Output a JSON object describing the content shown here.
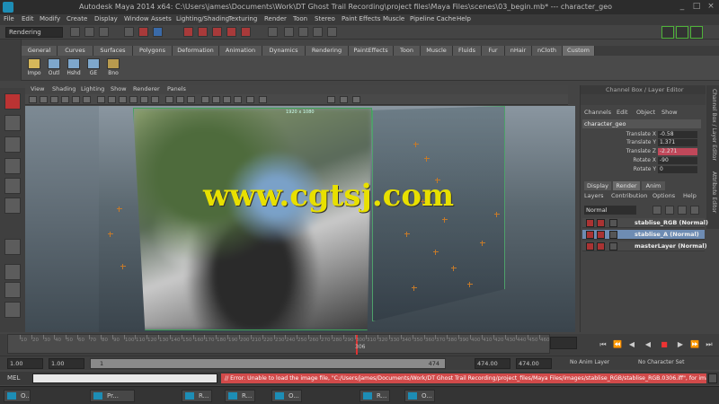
{
  "window": {
    "title": "Autodesk Maya 2014 x64: C:\\Users\\james\\Documents\\Work\\DT Ghost Trail Recording\\project files\\Maya Files\\scenes\\03_begin.mb*  ---  character_geo",
    "minimize": "_",
    "maximize": "□",
    "close": "×"
  },
  "menubar": [
    "File",
    "Edit",
    "Modify",
    "Create",
    "Display",
    "Window",
    "Assets",
    "Lighting/Shading",
    "Texturing",
    "Render",
    "Toon",
    "Stereo",
    "Paint Effects",
    "Muscle",
    "Pipeline Cache",
    "Help"
  ],
  "statusline": {
    "mode": "Rendering"
  },
  "shelf": {
    "tabs": [
      "General",
      "Curves",
      "Surfaces",
      "Polygons",
      "Deformation",
      "Animation",
      "Dynamics",
      "Rendering",
      "PaintEffects",
      "Toon",
      "Muscle",
      "Fluids",
      "Fur",
      "nHair",
      "nCloth",
      "Custom"
    ],
    "active_tab": "Custom",
    "items": [
      "Impo",
      "Outl",
      "Hshd",
      "GE",
      "Bno"
    ]
  },
  "panel_menu": [
    "View",
    "Shading",
    "Lighting",
    "Show",
    "Renderer",
    "Panels"
  ],
  "viewport": {
    "frame_label": "1920 x 1080",
    "watermark": "www.cgtsj.com"
  },
  "channel_box": {
    "header": "Channel Box / Layer Editor",
    "menu": [
      "Channels",
      "Edit",
      "Object",
      "Show"
    ],
    "object": "character_geo",
    "attributes": [
      {
        "name": "Translate X",
        "value": "-0.58"
      },
      {
        "name": "Translate Y",
        "value": "1.371"
      },
      {
        "name": "Translate Z",
        "value": "-2.271"
      },
      {
        "name": "Rotate X",
        "value": "-90"
      },
      {
        "name": "Rotate Y",
        "value": "0"
      }
    ]
  },
  "side_tabs": [
    "Channel Box / Layer Editor",
    "Attribute Editor"
  ],
  "layer_editor": {
    "tabs": [
      "Display",
      "Render",
      "Anim"
    ],
    "active_tab": "Render",
    "menu": [
      "Layers",
      "Contribution",
      "Options",
      "Help"
    ],
    "blend_mode": "Normal",
    "layers": [
      {
        "name": "stablise_RGB (Normal)",
        "selected": false
      },
      {
        "name": "stablise_A (Normal)",
        "selected": true
      },
      {
        "name": "masterLayer (Normal)",
        "selected": false
      }
    ]
  },
  "timeline": {
    "ticks": [
      "10",
      "20",
      "30",
      "40",
      "50",
      "60",
      "70",
      "80",
      "90",
      "100",
      "110",
      "120",
      "130",
      "140",
      "150",
      "160",
      "170",
      "180",
      "190",
      "200",
      "210",
      "220",
      "230",
      "240",
      "250",
      "260",
      "270",
      "280",
      "290",
      "300",
      "310",
      "320",
      "330",
      "340",
      "350",
      "360",
      "370",
      "380",
      "390",
      "400",
      "410",
      "420",
      "430",
      "440",
      "450",
      "460"
    ],
    "current_frame": "306",
    "current_fraction": 0.64
  },
  "range": {
    "start": "1.00",
    "playback_start": "1.00",
    "slider_label": "1",
    "slider_end": "474",
    "playback_end": "474.00",
    "end": "474.00",
    "anim_layer": "No Anim Layer",
    "char_set": "No Character Set"
  },
  "command_line": {
    "label": "MEL",
    "error": "// Error: Unable to load the image file, \"C:/Users/james/Documents/Work/DT Ghost Trail Recording/project_files/Maya Files/images/stablise_RGB/stablise_RGB.0306.iff\", for image plane"
  },
  "taskbar": [
    "O...",
    "Pr...",
    "R...",
    "R...",
    "O...",
    "R...",
    "O..."
  ]
}
